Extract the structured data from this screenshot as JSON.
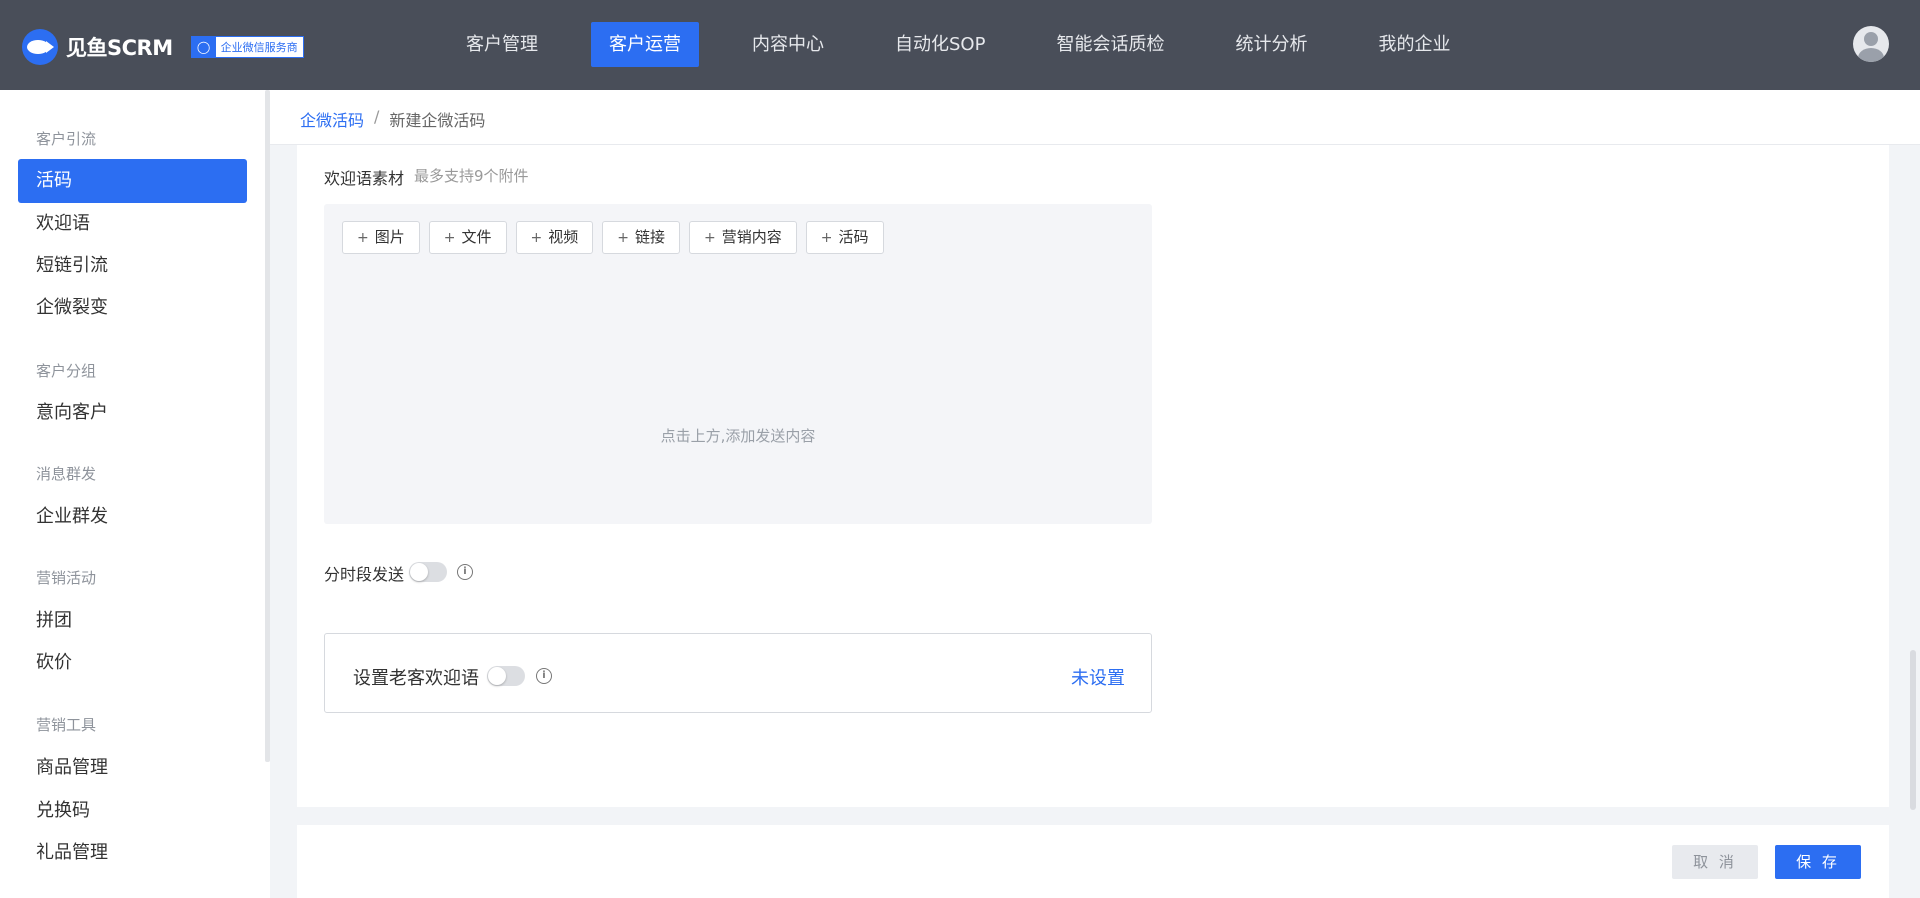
{
  "brand": {
    "name": "见鱼SCRM",
    "badge": "企业微信服务商"
  },
  "nav": [
    {
      "label": "客户管理",
      "active": false
    },
    {
      "label": "客户运营",
      "active": true
    },
    {
      "label": "内容中心",
      "active": false
    },
    {
      "label": "自动化SOP",
      "active": false
    },
    {
      "label": "智能会话质检",
      "active": false
    },
    {
      "label": "统计分析",
      "active": false
    },
    {
      "label": "我的企业",
      "active": false
    }
  ],
  "sidebar": {
    "groups": [
      {
        "title": "客户引流",
        "items": [
          "活码",
          "欢迎语",
          "短链引流",
          "企微裂变"
        ]
      },
      {
        "title": "客户分组",
        "items": [
          "意向客户"
        ]
      },
      {
        "title": "消息群发",
        "items": [
          "企业群发"
        ]
      },
      {
        "title": "营销活动",
        "items": [
          "拼团",
          "砍价"
        ]
      },
      {
        "title": "营销工具",
        "items": [
          "商品管理",
          "兑换码",
          "礼品管理"
        ]
      }
    ],
    "active_item": "活码"
  },
  "breadcrumb": {
    "parent": "企微活码",
    "separator": "/",
    "current": "新建企微活码"
  },
  "form": {
    "welcome_material_label": "欢迎语素材",
    "welcome_material_hint": "最多支持9个附件",
    "tools": [
      "图片",
      "文件",
      "视频",
      "链接",
      "营销内容",
      "活码"
    ],
    "editor_placeholder": "点击上方,添加发送内容",
    "timed_send_label": "分时段发送",
    "timed_send_enabled": false,
    "old_customer_label": "设置老客欢迎语",
    "old_customer_enabled": false,
    "old_customer_status": "未设置"
  },
  "footer": {
    "cancel_label": "取 消",
    "save_label": "保 存"
  },
  "colors": {
    "accent": "#2c6ef2",
    "topbar": "#494e59"
  }
}
